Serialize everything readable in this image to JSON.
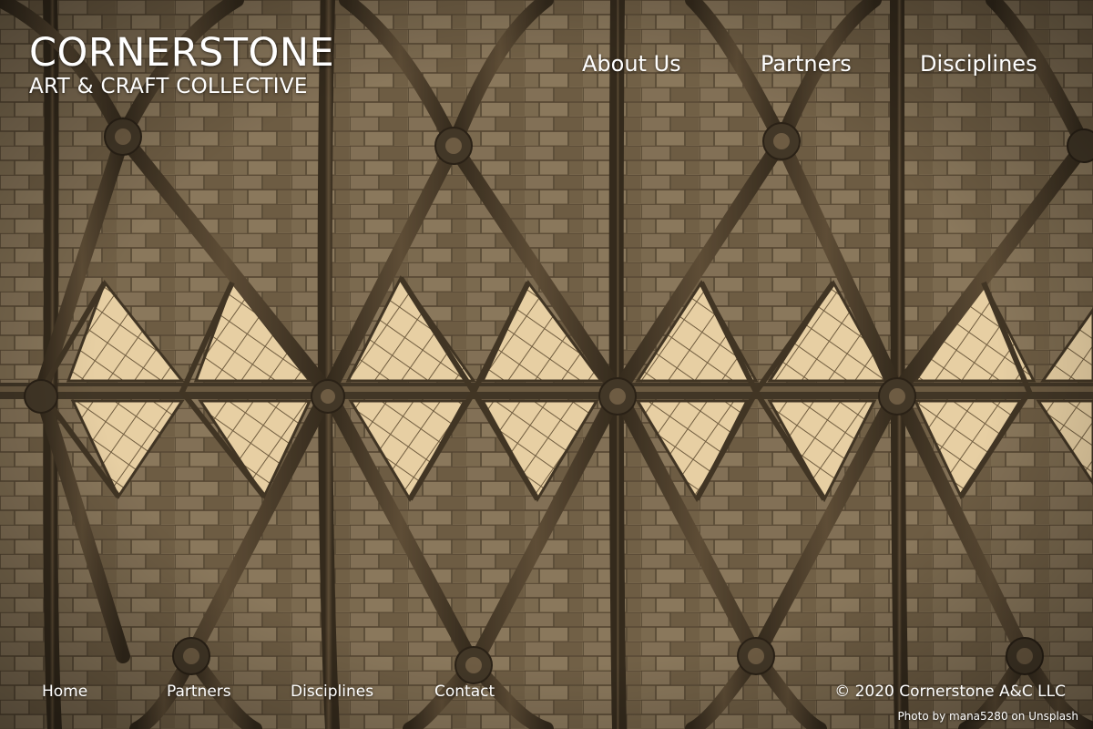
{
  "brand": {
    "name": "CORNERSTONE",
    "subtitle": "ART & CRAFT COLLECTIVE"
  },
  "top_nav": {
    "items": [
      {
        "label": "About Us"
      },
      {
        "label": "Partners"
      },
      {
        "label": "Disciplines"
      }
    ]
  },
  "footer_nav": {
    "items": [
      {
        "label": "Home"
      },
      {
        "label": "Partners"
      },
      {
        "label": "Disciplines"
      },
      {
        "label": "Contact"
      }
    ]
  },
  "footer": {
    "copyright": "© 2020 Cornerstone A&C LLC",
    "credit_prefix": "Photo by",
    "credit_author": "mana5280",
    "credit_middle": "on",
    "credit_source": "Unsplash"
  },
  "colors": {
    "text": "#ffffff",
    "sepia_dark": "#2e261b",
    "sepia_mid": "#7a6a52",
    "sepia_light": "#a8977a",
    "window_glow": "#f8e2b5"
  }
}
